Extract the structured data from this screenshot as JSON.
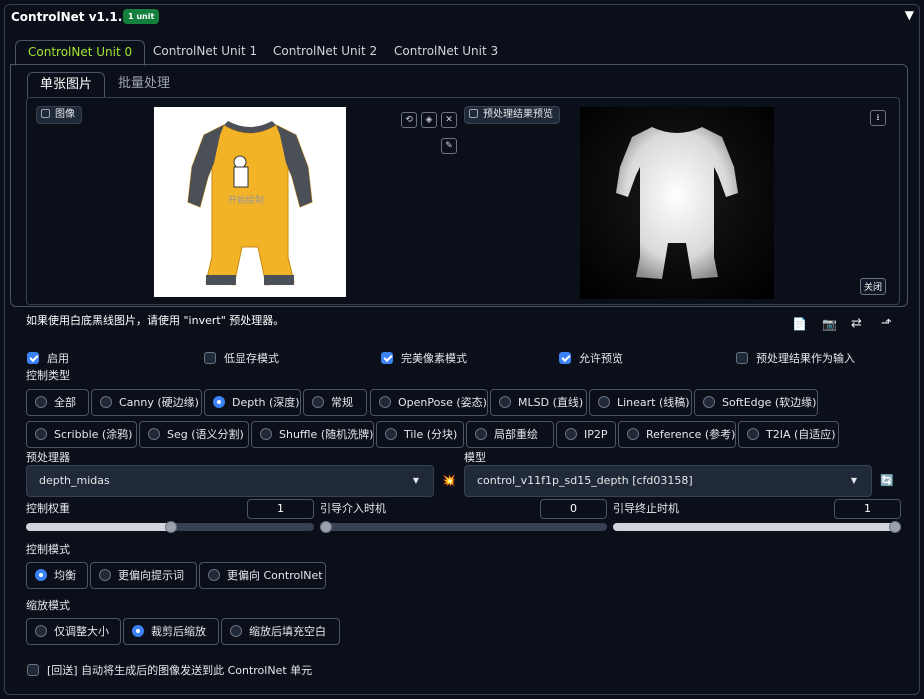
{
  "header": {
    "title": "ControlNet v1.1.224",
    "badge": "1 unit",
    "collapse_icon": "▼"
  },
  "unit_tabs": [
    {
      "label": "ControlNet Unit 0",
      "active": true
    },
    {
      "label": "ControlNet Unit 1",
      "active": false
    },
    {
      "label": "ControlNet Unit 2",
      "active": false
    },
    {
      "label": "ControlNet Unit 3",
      "active": false
    }
  ],
  "image_tabs": [
    {
      "label": "单张图片",
      "active": true
    },
    {
      "label": "批量处理",
      "active": false
    }
  ],
  "input_image": {
    "label": "图像",
    "watermark": "开始绘制",
    "buttons": {
      "undo": "⟲",
      "erase": "◈",
      "clear": "✕",
      "brush": "✎"
    }
  },
  "preview_image": {
    "label": "预处理结果预览",
    "download": "⭳",
    "close": "关闭"
  },
  "hint": "如果使用白底黑线图片，请使用 \"invert\" 预处理器。",
  "tools": {
    "new_canvas": "📄",
    "camera": "📷",
    "swap": "⇄",
    "send": "⬏"
  },
  "options": [
    {
      "label": "启用",
      "checked": true
    },
    {
      "label": "低显存模式",
      "checked": false
    },
    {
      "label": "完美像素模式",
      "checked": true
    },
    {
      "label": "允许预览",
      "checked": true
    },
    {
      "label": "预处理结果作为输入",
      "checked": false
    }
  ],
  "control_type": {
    "label": "控制类型",
    "items": [
      {
        "label": "全部",
        "selected": false
      },
      {
        "label": "Canny (硬边缘)",
        "selected": false
      },
      {
        "label": "Depth (深度)",
        "selected": true
      },
      {
        "label": "常规",
        "selected": false
      },
      {
        "label": "OpenPose (姿态)",
        "selected": false
      },
      {
        "label": "MLSD (直线)",
        "selected": false
      },
      {
        "label": "Lineart (线稿)",
        "selected": false
      },
      {
        "label": "SoftEdge (软边缘)",
        "selected": false
      },
      {
        "label": "Scribble (涂鸦)",
        "selected": false
      },
      {
        "label": "Seg (语义分割)",
        "selected": false
      },
      {
        "label": "Shuffle (随机洗牌)",
        "selected": false
      },
      {
        "label": "Tile (分块)",
        "selected": false
      },
      {
        "label": "局部重绘",
        "selected": false
      },
      {
        "label": "IP2P",
        "selected": false
      },
      {
        "label": "Reference (参考)",
        "selected": false
      },
      {
        "label": "T2IA (自适应)",
        "selected": false
      }
    ]
  },
  "preprocessor": {
    "label": "预处理器",
    "value": "depth_midas",
    "run_icon": "💥"
  },
  "model": {
    "label": "模型",
    "value": "control_v11f1p_sd15_depth [cfd03158]",
    "refresh_icon": "🔄"
  },
  "sliders": {
    "weight": {
      "label": "控制权重",
      "value": "1",
      "fraction": 0.5
    },
    "start": {
      "label": "引导介入时机",
      "value": "0",
      "fraction": 0.0
    },
    "end": {
      "label": "引导终止时机",
      "value": "1",
      "fraction": 1.0
    }
  },
  "control_mode": {
    "label": "控制模式",
    "items": [
      {
        "label": "均衡",
        "selected": true
      },
      {
        "label": "更偏向提示词",
        "selected": false
      },
      {
        "label": "更偏向 ControlNet",
        "selected": false
      }
    ]
  },
  "resize_mode": {
    "label": "缩放模式",
    "items": [
      {
        "label": "仅调整大小",
        "selected": false
      },
      {
        "label": "裁剪后缩放",
        "selected": true
      },
      {
        "label": "缩放后填充空白",
        "selected": false
      }
    ]
  },
  "loopback": {
    "label": "[回送] 自动将生成后的图像发送到此 ControlNet 单元",
    "checked": false
  }
}
